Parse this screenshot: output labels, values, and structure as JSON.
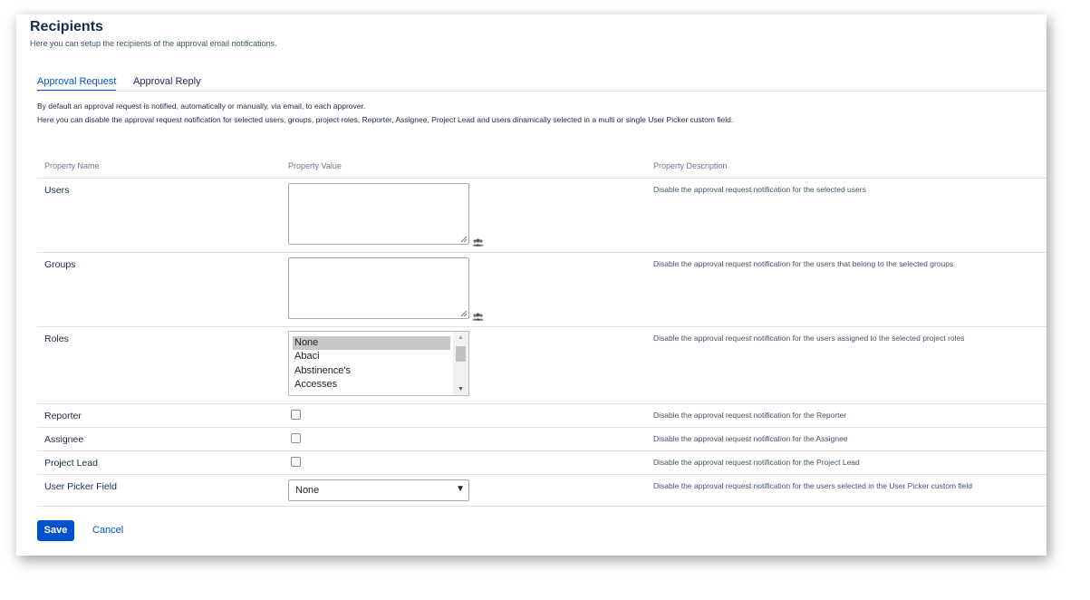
{
  "header": {
    "title": "Recipients",
    "subtitle": "Here you can setup the recipients of the approval email notifications."
  },
  "tabs": [
    {
      "label": "Approval Request",
      "active": true
    },
    {
      "label": "Approval Reply",
      "active": false
    }
  ],
  "description": {
    "line1": "By default an approval request is notified, automatically or manually, via email, to each approver.",
    "line2": "Here you can disable the approval request notification for selected users, groups, project roles, Reporter, Assignee, Project Lead and users dinamically selected in a multi or single User Picker custom field."
  },
  "table": {
    "headers": [
      "Property Name",
      "Property Value",
      "Property Description"
    ],
    "rows": [
      {
        "name": "Users",
        "control": "textarea",
        "value": "",
        "icon": "user-picker-icon",
        "description": "Disable the approval request notification for the selected users"
      },
      {
        "name": "Groups",
        "control": "textarea",
        "value": "",
        "icon": "group-picker-icon",
        "description": "Disable the approval request notification for the users that belong to the selected groups"
      },
      {
        "name": "Roles",
        "control": "multiselect",
        "options": [
          "None",
          "Abaci",
          "Abstinence's",
          "Accesses"
        ],
        "selected": "None",
        "description": "Disable the approval request notification for the users assigned to the selected project roles"
      },
      {
        "name": "Reporter",
        "control": "checkbox",
        "checked": false,
        "description": "Disable the approval request notification for the Reporter"
      },
      {
        "name": "Assignee",
        "control": "checkbox",
        "checked": false,
        "description": "Disable the approval request notification for the Assignee"
      },
      {
        "name": "Project Lead",
        "control": "checkbox",
        "checked": false,
        "description": "Disable the approval request notification for the Project Lead"
      },
      {
        "name": "User Picker Field",
        "control": "select",
        "value": "None",
        "description": "Disable the approval request notification for the users selected in the User Picker custom field"
      }
    ]
  },
  "actions": {
    "save_label": "Save",
    "cancel_label": "Cancel"
  },
  "colors": {
    "primary": "#0052cc",
    "text": "#172b4d",
    "muted": "#6b778c",
    "border": "#dfe1e6"
  }
}
